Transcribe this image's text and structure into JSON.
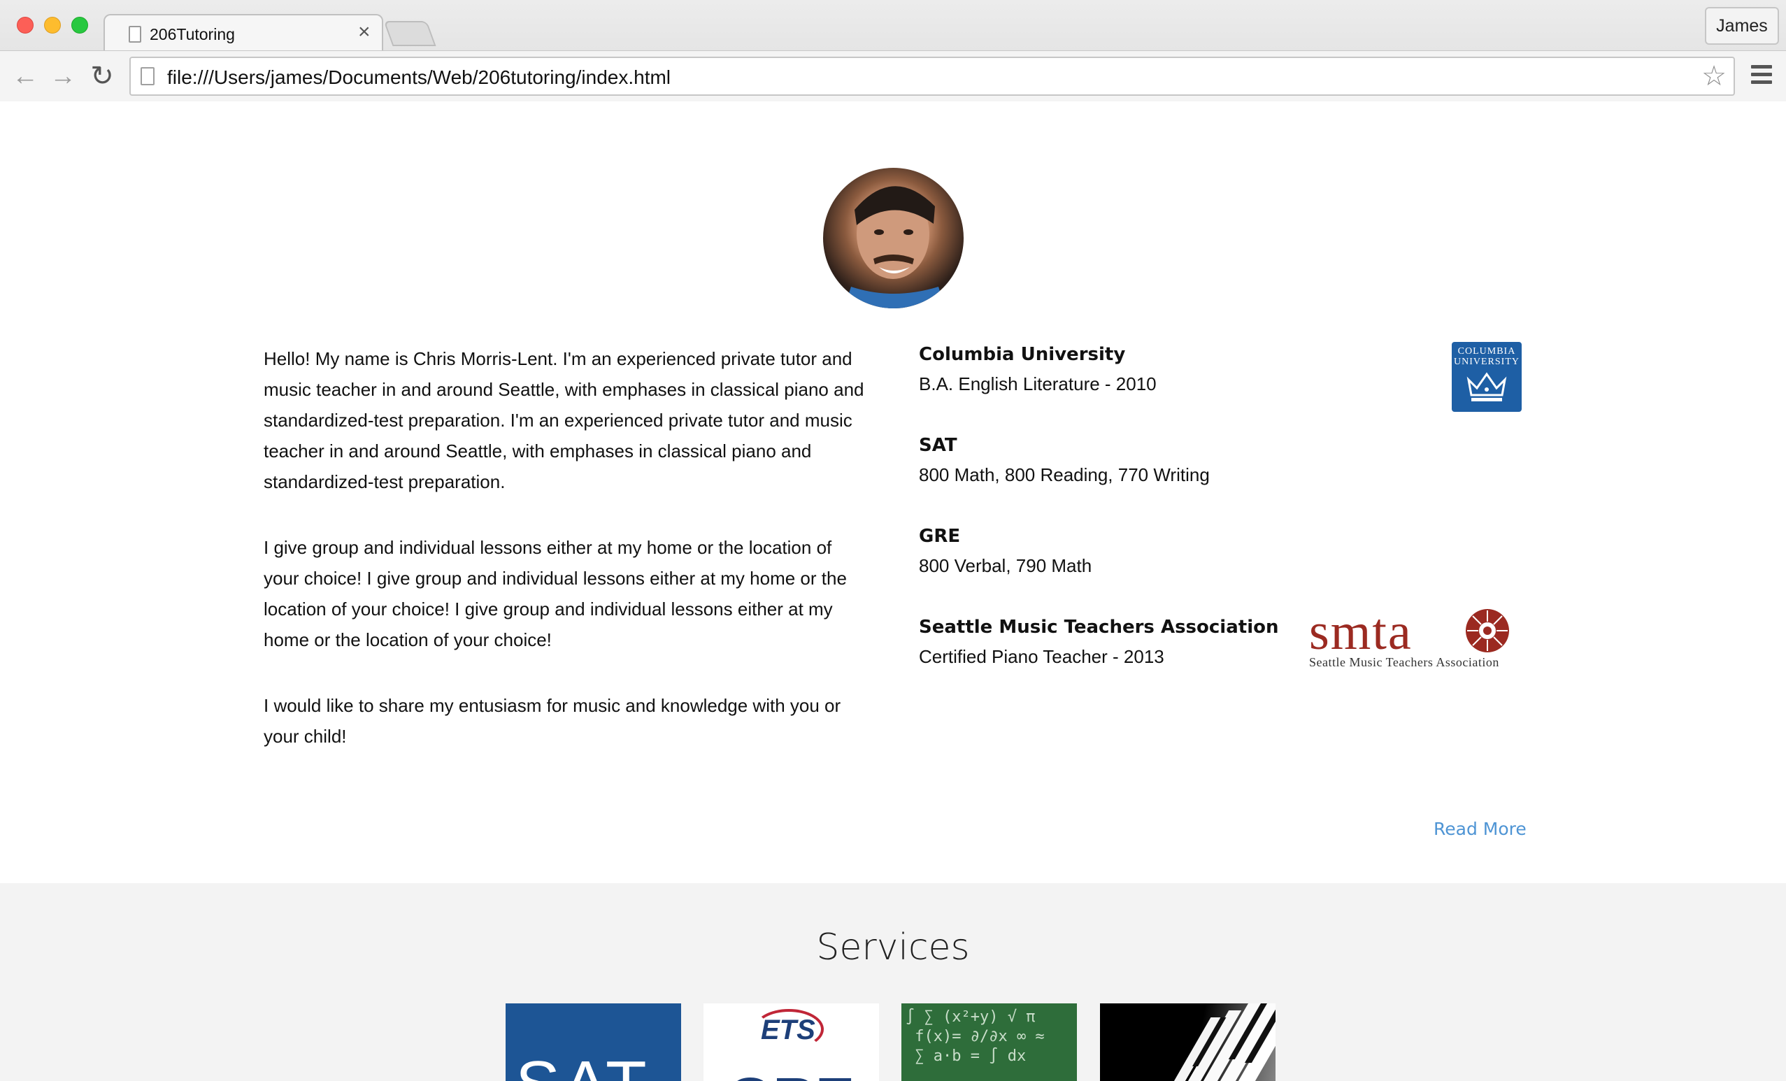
{
  "browser": {
    "tab_title": "206Tutoring",
    "tab_close": "×",
    "profile_name": "James",
    "url": "file:///Users/james/Documents/Web/206tutoring/index.html",
    "back_glyph": "←",
    "forward_glyph": "→",
    "reload_glyph": "↻",
    "star_glyph": "☆"
  },
  "bio": {
    "paragraphs": [
      "Hello! My name is Chris Morris-Lent. I'm an experienced private tutor and music teacher in and around Seattle, with emphases in classical piano and standardized-test preparation. I'm an experienced private tutor and music teacher in and around Seattle, with emphases in classical piano and standardized-test preparation.",
      "I give group and individual lessons either at my home or the location of your choice! I give group and individual lessons either at my home or the location of your choice! I give group and individual lessons either at my home or the location of your choice!",
      "I would like to share my entusiasm for music and knowledge with you or your child!"
    ]
  },
  "credentials": [
    {
      "title": "Columbia University",
      "detail": "B.A. English Literature - 2010",
      "logo_text": "COLUMBIA UNIVERSITY"
    },
    {
      "title": "SAT",
      "detail": "800 Math, 800 Reading, 770 Writing"
    },
    {
      "title": "GRE",
      "detail": "800 Verbal, 790 Math"
    },
    {
      "title": "Seattle Music Teachers Association",
      "detail": "Certified Piano Teacher - 2013",
      "logo_word": "smta",
      "logo_sub": "Seattle Music Teachers Association"
    }
  ],
  "read_more": "Read More",
  "services": {
    "title": "Services",
    "tiles": [
      {
        "name": "SAT",
        "text": "SAT"
      },
      {
        "name": "GRE",
        "brand": "ETS",
        "text": "GRE"
      },
      {
        "name": "Math"
      },
      {
        "name": "Piano"
      }
    ]
  },
  "colors": {
    "link": "#4e94d4",
    "columbia_blue": "#1e5fa5",
    "smta_red": "#9b2a21",
    "services_bg": "#f3f3f3"
  }
}
